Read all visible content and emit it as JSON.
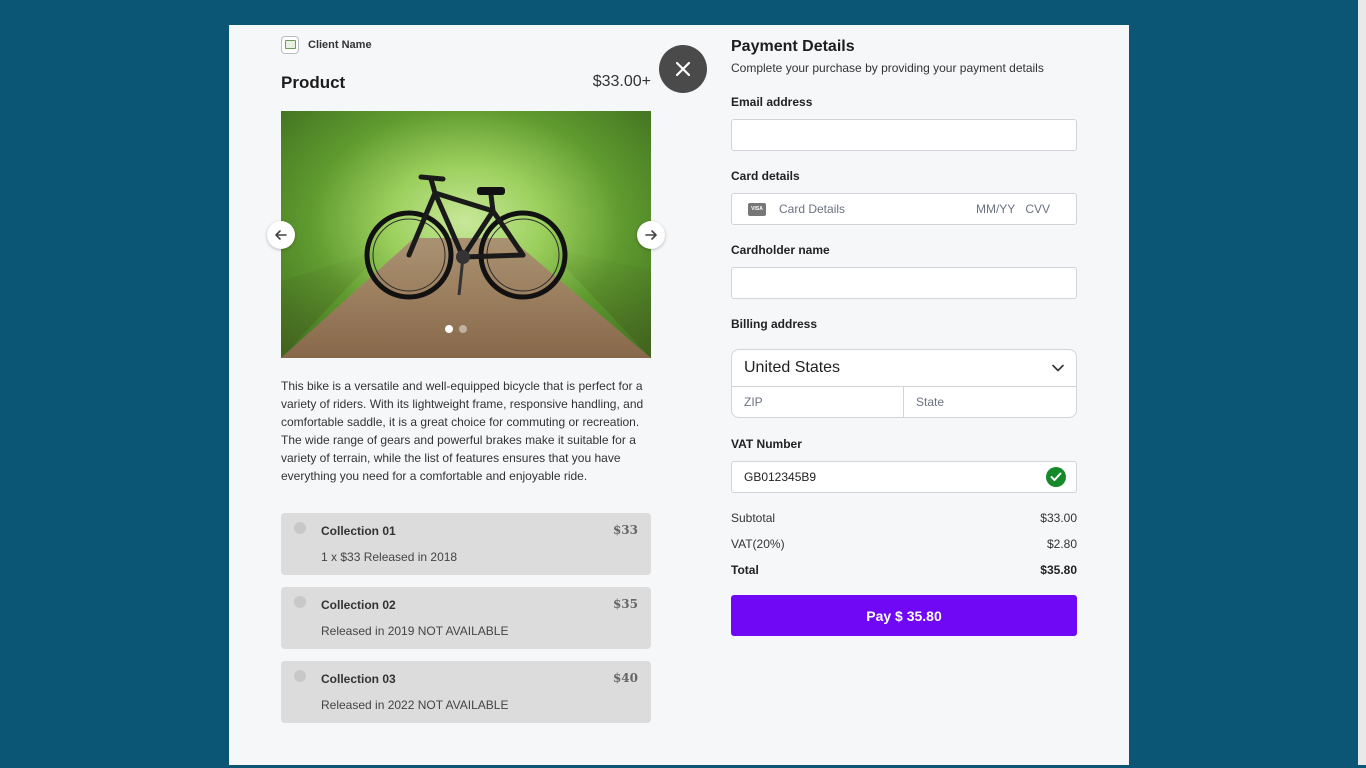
{
  "client": {
    "name": "Client Name"
  },
  "product": {
    "title": "Product",
    "price": "$33.00+",
    "description": "This bike is a versatile and well-equipped bicycle that is perfect for a variety of riders. With its lightweight frame, responsive handling, and comfortable saddle, it is a great choice for commuting or recreation. The wide range of gears and powerful brakes make it suitable for a variety of terrain, while the list of features ensures that you have everything you need for a comfortable and enjoyable ride.",
    "carousel": {
      "slide_count": 2,
      "active_index": 0,
      "prev_icon": "arrow-left-icon",
      "next_icon": "arrow-right-icon"
    }
  },
  "collections": [
    {
      "name": "Collection 01",
      "price": "$33",
      "detail": "1 x $33 Released in 2018"
    },
    {
      "name": "Collection 02",
      "price": "$35",
      "detail": "Released in 2019 NOT AVAILABLE"
    },
    {
      "name": "Collection 03",
      "price": "$40",
      "detail": "Released in 2022 NOT AVAILABLE"
    }
  ],
  "close": {
    "icon": "close-icon"
  },
  "payment": {
    "title": "Payment Details",
    "subtitle": "Complete your purchase by providing your payment details",
    "email_label": "Email address",
    "email_value": "",
    "card_label": "Card details",
    "card_icon": "visa-card-icon",
    "card_brand_text": "VISA",
    "card_placeholder": "Card Details",
    "expiry_placeholder": "MM/YY",
    "cvv_placeholder": "CVV",
    "cardholder_label": "Cardholder name",
    "cardholder_value": "",
    "billing_label": "Billing address",
    "country": "United States",
    "zip_placeholder": "ZIP",
    "state_placeholder": "State",
    "vat_label": "VAT Number",
    "vat_value": "GB012345B9",
    "vat_valid": true
  },
  "summary": {
    "subtotal_label": "Subtotal",
    "subtotal_value": "$33.00",
    "vat_label": "VAT(20%)",
    "vat_value": "$2.80",
    "total_label": "Total",
    "total_value": "$35.80"
  },
  "pay_button": {
    "label": "Pay $ 35.80"
  },
  "colors": {
    "backdrop": "#0b5675",
    "modal": "#f6f7f9",
    "pay_button": "#7008f6",
    "valid_check": "#168a2a",
    "collection_bg": "#dcdcdc"
  }
}
